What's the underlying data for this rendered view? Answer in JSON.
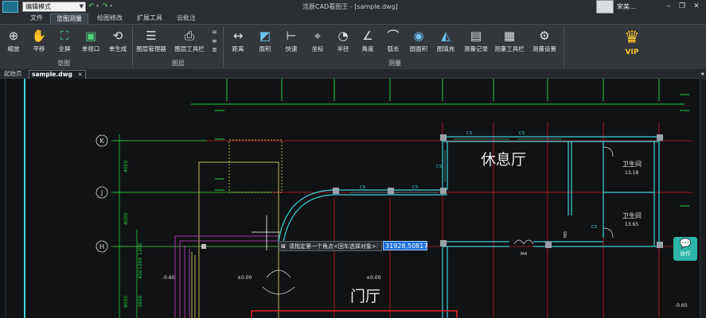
{
  "titlebar": {
    "mode": "编辑模式",
    "title": "浩辰CAD看图王 - [sample.dwg]",
    "user": "宋美...",
    "quick_icons": [
      "undo-icon",
      "undo-menu-icon",
      "redo-icon",
      "redo-menu-icon"
    ],
    "window_buttons": [
      "minimize-icon",
      "restore-icon",
      "close-icon"
    ]
  },
  "menu": {
    "tabs": [
      "文件",
      "览图测量",
      "绘图修改",
      "扩展工具",
      "云批注"
    ],
    "active": 1
  },
  "ribbon": {
    "view_group": {
      "label": "览图",
      "tools": [
        {
          "label": "缩放",
          "icon": "zoom-icon"
        },
        {
          "label": "平移",
          "icon": "pan-hand-icon"
        },
        {
          "label": "全屏",
          "icon": "fullscreen-icon"
        },
        {
          "label": "单视口",
          "icon": "single-viewport-icon"
        },
        {
          "label": "单生成",
          "icon": "regenerate-icon"
        }
      ]
    },
    "layer_group": {
      "label": "图层",
      "tools": [
        {
          "label": "图层管理器",
          "icon": "layer-manager-icon"
        },
        {
          "label": "图层工具栏",
          "icon": "layer-toolbar-icon"
        }
      ]
    },
    "measure_group": {
      "label": "测量",
      "tools": [
        {
          "label": "距离",
          "icon": "distance-icon"
        },
        {
          "label": "面积",
          "icon": "area-icon"
        },
        {
          "label": "快速",
          "icon": "quick-measure-icon"
        },
        {
          "label": "坐标",
          "icon": "coordinate-icon"
        },
        {
          "label": "半径",
          "icon": "radius-icon"
        },
        {
          "label": "角度",
          "icon": "angle-icon"
        },
        {
          "label": "弧长",
          "icon": "arc-length-icon"
        },
        {
          "label": "圆面积",
          "icon": "circle-area-icon"
        },
        {
          "label": "图填充",
          "icon": "hatch-fill-icon"
        },
        {
          "label": "测量记录",
          "icon": "measure-record-icon"
        },
        {
          "label": "测量工具栏",
          "icon": "measure-toolbar-icon"
        },
        {
          "label": "测量设置",
          "icon": "measure-settings-icon"
        }
      ]
    },
    "vip": {
      "label": "VIP",
      "icon": "crown-icon"
    }
  },
  "doc_tabs": [
    {
      "label": "起始页",
      "active": false
    },
    {
      "label": "sample.dwg",
      "active": true
    }
  ],
  "drawing": {
    "grid_labels": [
      "K",
      "J",
      "H"
    ],
    "dims_left": [
      "4000",
      "4000",
      "8000"
    ],
    "dims_left2": [
      "1200",
      "1200",
      "450",
      "3600"
    ],
    "rooms": [
      "休息厅",
      "门厅",
      "卫生间",
      "卫生间"
    ],
    "room_areas": [
      "13.18",
      "13.65"
    ],
    "window_tags": [
      "C5",
      "C5",
      "C5",
      "C5",
      "C5",
      "C5"
    ],
    "door_tags": [
      "M4",
      "M5"
    ],
    "levels": [
      "-0.60",
      "±0.00",
      "±0.00",
      "-0.60"
    ]
  },
  "command": {
    "prompt": "请指定第一个角点<回车选择对象>:",
    "value": "31928,50817"
  },
  "support": {
    "label": "协作",
    "icon": "chat-support-icon"
  },
  "colors": {
    "ribbon_bg": "#33373c",
    "canvas_bg": "#101214",
    "wall_cyan": "#3fd0d8",
    "axis_red": "#e02020",
    "dim_green": "#20d040",
    "yellow": "#e8e060",
    "magenta": "#d040d0",
    "vip_gold": "#f6c22c"
  }
}
